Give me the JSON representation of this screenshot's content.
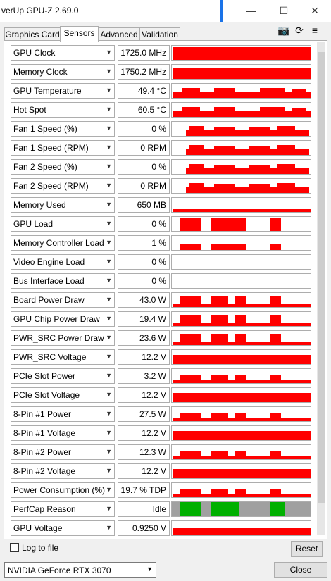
{
  "window": {
    "title": "verUp GPU-Z 2.69.0",
    "minimize": "—",
    "maximize": "☐",
    "close": "✕"
  },
  "tabs": [
    "Graphics Card",
    "Sensors",
    "Advanced",
    "Validation"
  ],
  "sensors": [
    {
      "name": "GPU Clock",
      "value": "1725.0 MHz"
    },
    {
      "name": "Memory Clock",
      "value": "1750.2 MHz"
    },
    {
      "name": "GPU Temperature",
      "value": "49.4 °C"
    },
    {
      "name": "Hot Spot",
      "value": "60.5 °C"
    },
    {
      "name": "Fan 1 Speed (%)",
      "value": "0 %"
    },
    {
      "name": "Fan 1 Speed (RPM)",
      "value": "0 RPM"
    },
    {
      "name": "Fan 2 Speed (%)",
      "value": "0 %"
    },
    {
      "name": "Fan 2 Speed (RPM)",
      "value": "0 RPM"
    },
    {
      "name": "Memory Used",
      "value": "650 MB"
    },
    {
      "name": "GPU Load",
      "value": "0 %"
    },
    {
      "name": "Memory Controller Load",
      "value": "1 %"
    },
    {
      "name": "Video Engine Load",
      "value": "0 %"
    },
    {
      "name": "Bus Interface Load",
      "value": "0 %"
    },
    {
      "name": "Board Power Draw",
      "value": "43.0 W"
    },
    {
      "name": "GPU Chip Power Draw",
      "value": "19.4 W"
    },
    {
      "name": "PWR_SRC Power Draw",
      "value": "23.6 W"
    },
    {
      "name": "PWR_SRC Voltage",
      "value": "12.2 V"
    },
    {
      "name": "PCIe Slot Power",
      "value": "3.2 W"
    },
    {
      "name": "PCIe Slot Voltage",
      "value": "12.2 V"
    },
    {
      "name": "8-Pin #1 Power",
      "value": "27.5 W"
    },
    {
      "name": "8-Pin #1 Voltage",
      "value": "12.2 V"
    },
    {
      "name": "8-Pin #2 Power",
      "value": "12.3 W"
    },
    {
      "name": "8-Pin #2 Voltage",
      "value": "12.2 V"
    },
    {
      "name": "Power Consumption (%)",
      "value": "19.7 % TDP"
    },
    {
      "name": "PerfCap Reason",
      "value": "Idle"
    },
    {
      "name": "GPU Voltage",
      "value": "0.9250 V"
    }
  ],
  "log_to_file": "Log to file",
  "reset": "Reset",
  "gpu_select": "NVIDIA GeForce RTX 3070",
  "close": "Close",
  "colors": {
    "graph": "#ff0000",
    "accent": "#1a73e8",
    "perfcap_idle": "#00b000",
    "perfcap_off": "#a0a0a0"
  }
}
